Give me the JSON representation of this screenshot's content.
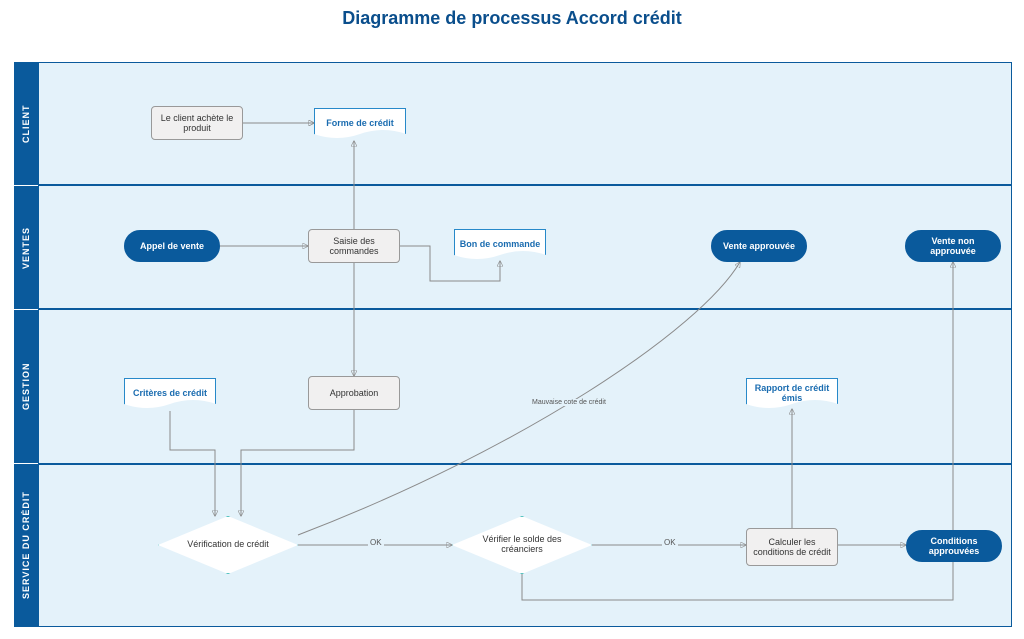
{
  "title": "Diagramme de processus Accord crédit",
  "lanes": {
    "client": "CLIENT",
    "ventes": "VENTES",
    "gestion": "GESTION",
    "credit": "SERVICE DU CRÉDIT"
  },
  "nodes": {
    "achete": "Le client achète le produit",
    "forme_credit": "Forme de crédit",
    "appel_vente": "Appel de vente",
    "saisie_commandes": "Saisie des commandes",
    "bon_commande": "Bon de commande",
    "vente_approuvee": "Vente approuvée",
    "vente_non_approuvee": "Vente non approuvée",
    "criteres_credit": "Critères de crédit",
    "approbation": "Approbation",
    "rapport_credit": "Rapport de crédit émis",
    "verif_credit": "Vérification de crédit",
    "verif_solde": "Vérifier le solde des créanciers",
    "calculer_cond": "Calculer les conditions de crédit",
    "conditions_appr": "Conditions approuvées"
  },
  "edge_labels": {
    "ok1": "OK",
    "ok2": "OK",
    "mauvaise": "Mauvaise cote de crédit"
  },
  "chart_data": {
    "type": "flowchart_swimlane",
    "title": "Diagramme de processus Accord crédit",
    "lanes": [
      "CLIENT",
      "VENTES",
      "GESTION",
      "SERVICE DU CRÉDIT"
    ],
    "nodes": [
      {
        "id": "achete",
        "lane": "CLIENT",
        "shape": "process",
        "label": "Le client achète le produit"
      },
      {
        "id": "forme_credit",
        "lane": "CLIENT",
        "shape": "document",
        "label": "Forme de crédit"
      },
      {
        "id": "appel_vente",
        "lane": "VENTES",
        "shape": "terminator",
        "label": "Appel de vente",
        "start": true
      },
      {
        "id": "saisie_commandes",
        "lane": "VENTES",
        "shape": "process",
        "label": "Saisie des commandes"
      },
      {
        "id": "bon_commande",
        "lane": "VENTES",
        "shape": "document",
        "label": "Bon de commande"
      },
      {
        "id": "vente_approuvee",
        "lane": "VENTES",
        "shape": "terminator",
        "label": "Vente approuvée",
        "end": true
      },
      {
        "id": "vente_non_approuvee",
        "lane": "VENTES",
        "shape": "terminator",
        "label": "Vente non approuvée",
        "end": true
      },
      {
        "id": "criteres_credit",
        "lane": "GESTION",
        "shape": "document",
        "label": "Critères de crédit"
      },
      {
        "id": "approbation",
        "lane": "GESTION",
        "shape": "process",
        "label": "Approbation"
      },
      {
        "id": "rapport_credit",
        "lane": "GESTION",
        "shape": "document",
        "label": "Rapport de crédit émis"
      },
      {
        "id": "verif_credit",
        "lane": "SERVICE DU CRÉDIT",
        "shape": "decision",
        "label": "Vérification de crédit"
      },
      {
        "id": "verif_solde",
        "lane": "SERVICE DU CRÉDIT",
        "shape": "decision",
        "label": "Vérifier le solde des créanciers"
      },
      {
        "id": "calculer_cond",
        "lane": "SERVICE DU CRÉDIT",
        "shape": "process",
        "label": "Calculer les conditions de crédit"
      },
      {
        "id": "conditions_appr",
        "lane": "SERVICE DU CRÉDIT",
        "shape": "terminator",
        "label": "Conditions approuvées",
        "end": true
      }
    ],
    "edges": [
      {
        "from": "appel_vente",
        "to": "saisie_commandes"
      },
      {
        "from": "saisie_commandes",
        "to": "achete"
      },
      {
        "from": "achete",
        "to": "forme_credit"
      },
      {
        "from": "saisie_commandes",
        "to": "bon_commande"
      },
      {
        "from": "saisie_commandes",
        "to": "approbation"
      },
      {
        "from": "approbation",
        "to": "verif_credit"
      },
      {
        "from": "criteres_credit",
        "to": "verif_credit"
      },
      {
        "from": "bon_commande",
        "to": "verif_credit"
      },
      {
        "from": "verif_credit",
        "to": "verif_solde",
        "label": "OK"
      },
      {
        "from": "verif_solde",
        "to": "calculer_cond",
        "label": "OK"
      },
      {
        "from": "verif_credit",
        "to": "vente_approuvee",
        "label": "Mauvaise cote de crédit"
      },
      {
        "from": "calculer_cond",
        "to": "rapport_credit"
      },
      {
        "from": "calculer_cond",
        "to": "conditions_appr"
      },
      {
        "from": "verif_solde",
        "to": "vente_non_approuvee"
      }
    ]
  }
}
